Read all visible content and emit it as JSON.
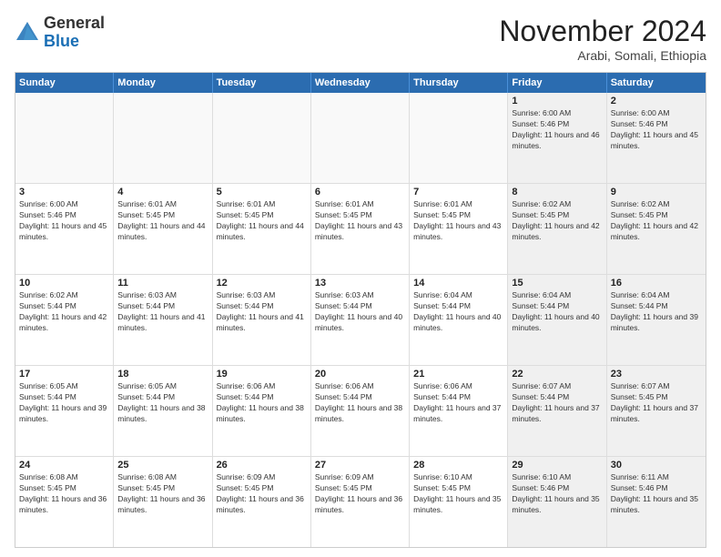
{
  "header": {
    "logo_general": "General",
    "logo_blue": "Blue",
    "month_title": "November 2024",
    "subtitle": "Arabi, Somali, Ethiopia"
  },
  "calendar": {
    "weekdays": [
      "Sunday",
      "Monday",
      "Tuesday",
      "Wednesday",
      "Thursday",
      "Friday",
      "Saturday"
    ],
    "rows": [
      {
        "cells": [
          {
            "day": "",
            "text": "",
            "empty": true
          },
          {
            "day": "",
            "text": "",
            "empty": true
          },
          {
            "day": "",
            "text": "",
            "empty": true
          },
          {
            "day": "",
            "text": "",
            "empty": true
          },
          {
            "day": "",
            "text": "",
            "empty": true
          },
          {
            "day": "1",
            "text": "Sunrise: 6:00 AM\nSunset: 5:46 PM\nDaylight: 11 hours and 46 minutes.",
            "shaded": true
          },
          {
            "day": "2",
            "text": "Sunrise: 6:00 AM\nSunset: 5:46 PM\nDaylight: 11 hours and 45 minutes.",
            "shaded": true
          }
        ]
      },
      {
        "cells": [
          {
            "day": "3",
            "text": "Sunrise: 6:00 AM\nSunset: 5:46 PM\nDaylight: 11 hours and 45 minutes."
          },
          {
            "day": "4",
            "text": "Sunrise: 6:01 AM\nSunset: 5:45 PM\nDaylight: 11 hours and 44 minutes."
          },
          {
            "day": "5",
            "text": "Sunrise: 6:01 AM\nSunset: 5:45 PM\nDaylight: 11 hours and 44 minutes."
          },
          {
            "day": "6",
            "text": "Sunrise: 6:01 AM\nSunset: 5:45 PM\nDaylight: 11 hours and 43 minutes."
          },
          {
            "day": "7",
            "text": "Sunrise: 6:01 AM\nSunset: 5:45 PM\nDaylight: 11 hours and 43 minutes."
          },
          {
            "day": "8",
            "text": "Sunrise: 6:02 AM\nSunset: 5:45 PM\nDaylight: 11 hours and 42 minutes.",
            "shaded": true
          },
          {
            "day": "9",
            "text": "Sunrise: 6:02 AM\nSunset: 5:45 PM\nDaylight: 11 hours and 42 minutes.",
            "shaded": true
          }
        ]
      },
      {
        "cells": [
          {
            "day": "10",
            "text": "Sunrise: 6:02 AM\nSunset: 5:44 PM\nDaylight: 11 hours and 42 minutes."
          },
          {
            "day": "11",
            "text": "Sunrise: 6:03 AM\nSunset: 5:44 PM\nDaylight: 11 hours and 41 minutes."
          },
          {
            "day": "12",
            "text": "Sunrise: 6:03 AM\nSunset: 5:44 PM\nDaylight: 11 hours and 41 minutes."
          },
          {
            "day": "13",
            "text": "Sunrise: 6:03 AM\nSunset: 5:44 PM\nDaylight: 11 hours and 40 minutes."
          },
          {
            "day": "14",
            "text": "Sunrise: 6:04 AM\nSunset: 5:44 PM\nDaylight: 11 hours and 40 minutes."
          },
          {
            "day": "15",
            "text": "Sunrise: 6:04 AM\nSunset: 5:44 PM\nDaylight: 11 hours and 40 minutes.",
            "shaded": true
          },
          {
            "day": "16",
            "text": "Sunrise: 6:04 AM\nSunset: 5:44 PM\nDaylight: 11 hours and 39 minutes.",
            "shaded": true
          }
        ]
      },
      {
        "cells": [
          {
            "day": "17",
            "text": "Sunrise: 6:05 AM\nSunset: 5:44 PM\nDaylight: 11 hours and 39 minutes."
          },
          {
            "day": "18",
            "text": "Sunrise: 6:05 AM\nSunset: 5:44 PM\nDaylight: 11 hours and 38 minutes."
          },
          {
            "day": "19",
            "text": "Sunrise: 6:06 AM\nSunset: 5:44 PM\nDaylight: 11 hours and 38 minutes."
          },
          {
            "day": "20",
            "text": "Sunrise: 6:06 AM\nSunset: 5:44 PM\nDaylight: 11 hours and 38 minutes."
          },
          {
            "day": "21",
            "text": "Sunrise: 6:06 AM\nSunset: 5:44 PM\nDaylight: 11 hours and 37 minutes."
          },
          {
            "day": "22",
            "text": "Sunrise: 6:07 AM\nSunset: 5:44 PM\nDaylight: 11 hours and 37 minutes.",
            "shaded": true
          },
          {
            "day": "23",
            "text": "Sunrise: 6:07 AM\nSunset: 5:45 PM\nDaylight: 11 hours and 37 minutes.",
            "shaded": true
          }
        ]
      },
      {
        "cells": [
          {
            "day": "24",
            "text": "Sunrise: 6:08 AM\nSunset: 5:45 PM\nDaylight: 11 hours and 36 minutes."
          },
          {
            "day": "25",
            "text": "Sunrise: 6:08 AM\nSunset: 5:45 PM\nDaylight: 11 hours and 36 minutes."
          },
          {
            "day": "26",
            "text": "Sunrise: 6:09 AM\nSunset: 5:45 PM\nDaylight: 11 hours and 36 minutes."
          },
          {
            "day": "27",
            "text": "Sunrise: 6:09 AM\nSunset: 5:45 PM\nDaylight: 11 hours and 36 minutes."
          },
          {
            "day": "28",
            "text": "Sunrise: 6:10 AM\nSunset: 5:45 PM\nDaylight: 11 hours and 35 minutes."
          },
          {
            "day": "29",
            "text": "Sunrise: 6:10 AM\nSunset: 5:46 PM\nDaylight: 11 hours and 35 minutes.",
            "shaded": true
          },
          {
            "day": "30",
            "text": "Sunrise: 6:11 AM\nSunset: 5:46 PM\nDaylight: 11 hours and 35 minutes.",
            "shaded": true
          }
        ]
      }
    ]
  }
}
